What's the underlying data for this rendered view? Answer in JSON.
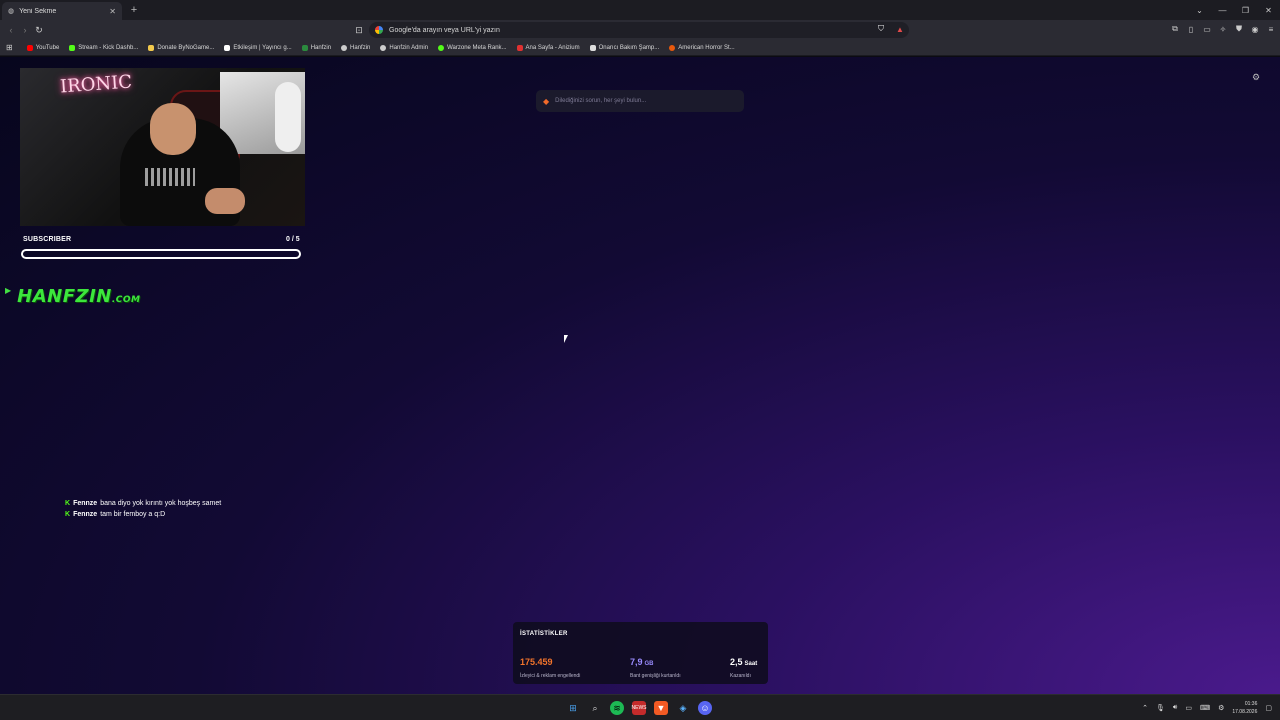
{
  "browser": {
    "tab_title": "Yeni Sekme",
    "omnibox_placeholder": "Google'da arayın veya URL'yi yazın",
    "bookmarks": [
      {
        "label": "YouTube",
        "color": "#ff0000"
      },
      {
        "label": "Stream - Kick Dashb...",
        "color": "#53fc18"
      },
      {
        "label": "Donate ByNoGame...",
        "color": "#f2c94c"
      },
      {
        "label": "Etkileşim | Yayıncı g...",
        "color": "#ffffff"
      },
      {
        "label": "Hanfzin",
        "color": "#2b8a3e"
      },
      {
        "label": "Hanfzin",
        "color": "#cccccc"
      },
      {
        "label": "Hanfzin Admin",
        "color": "#cccccc"
      },
      {
        "label": "Warzone Meta Rank...",
        "color": "#53fc18"
      },
      {
        "label": "Ana Sayfa - Anizium",
        "color": "#e03131"
      },
      {
        "label": "Onarıcı Bakım Şamp...",
        "color": "#dddddd"
      },
      {
        "label": "American Horror St...",
        "color": "#e8590c"
      }
    ]
  },
  "overlay": {
    "cam_sign": "IRONIC",
    "subscriber_label": "SUBSCRIBER",
    "subscriber_count": "0 / 5",
    "subscriber_progress": 0,
    "brand": "HANFZIN",
    "brand_tld": ".COM",
    "chat": [
      {
        "user": "Fennze",
        "text": "bana diyo yok kırıntı yok hoşbeş samet"
      },
      {
        "user": "Fennze",
        "text": "tam bir femboy a q:D"
      }
    ]
  },
  "newtab": {
    "search_placeholder": "Dilediğinizi sorun, her şeyi bulun...",
    "stats_title": "İSTATİSTİKLER",
    "stats": [
      {
        "value": "175.459",
        "unit": "",
        "label": "İzleyici & reklam engellendi",
        "color": "#f2742b"
      },
      {
        "value": "7,9",
        "unit": "GB",
        "label": "Bant genişliği kurtarıldı",
        "color": "#9a8cff"
      },
      {
        "value": "2,5",
        "unit": "Saat",
        "label": "Kazanıldı",
        "color": "#ffffff"
      }
    ]
  },
  "taskbar": {
    "time": "01:36",
    "date": "17.08.2026"
  }
}
